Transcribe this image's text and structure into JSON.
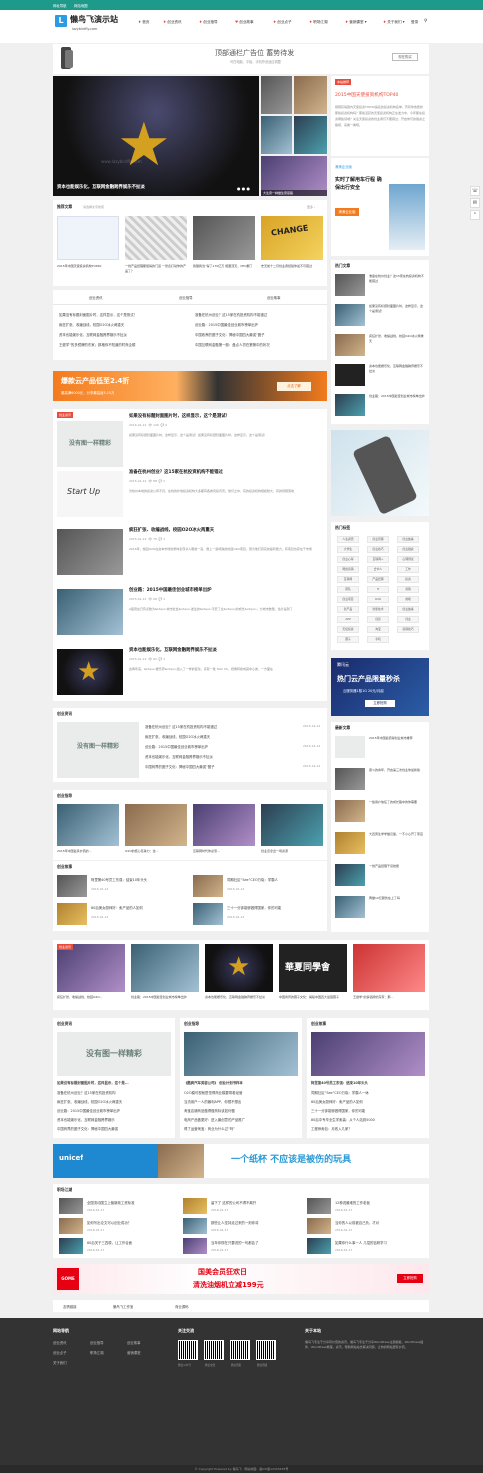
{
  "topbar": {
    "link1": "网址导航",
    "link2": "网站地图"
  },
  "header": {
    "logo_letter": "L",
    "title": "懒鸟飞演示站",
    "subtitle": "lazybirdfly.com",
    "nav": [
      "首页",
      "创业资讯",
      "创业指导",
      "创业故事",
      "创业点子",
      "职场江湖",
      "营销课堂 ▾",
      "关于我们 ▾"
    ],
    "login": "登录"
  },
  "banner": {
    "line1": "顶部通栏广告位 蓄势待发",
    "line2": "可在电脑、平板、手机外设适应调整",
    "button": "现在购买"
  },
  "slider": {
    "main_caption": "资本也能娱乐化，互联网金融跨界娱乐不扯淡",
    "watermark": "www.lazybirdfly.com",
    "caption_b": "大生意一种做生意思路"
  },
  "hot": {
    "badge": "本站推荐",
    "title": "2015中国天使投资机构TOP40",
    "desc": "刚刚获得国内天使投资TOP40提名的投资机构名单，芳有你熟悉的那些投资机构吗？那些活跃的天使投资机构正在发力中，今年都在投资哪些领域？关注天使投资的创业者们不要错过，开启你们的融资之路吧，来看一看吧。"
  },
  "ad_card": {
    "brand": "滴滴企业版",
    "head": "实时了解用车行程 确保出行安全",
    "sub": "滴滴企业版"
  },
  "recommend": {
    "title": "推荐文章",
    "search_hint": "请选择文字搜索",
    "more": "更多 ›",
    "items": [
      "2015年中国天使投资机构TOP40",
      "一线产品经理都懂得的门道 一张表打动你的产品了？",
      "我赌我当“得了170亿万 能跟顶天，CEO翻了",
      "史无前十二月创业者经验你最不可错过"
    ]
  },
  "tabs": {
    "t1": "创业资讯",
    "t2": "创业指导",
    "t3": "创业故事",
    "col1": [
      "如果没有标题封面图片时，这样显示，这个是测试！",
      "疯狂扩张、收编战线，校园O2O冰火两重天",
      "资本也能娱乐化，互联网金融跨界娱乐不扯淡",
      "王健学“的多镜牌的东家；那格你不知道的时商企顺"
    ],
    "col2": [
      "准备在杭州创业？这15家在杭投资机构不能错过",
      "创业路：2015中国最佳创业城市榜单出炉",
      "中国收养的圈子文化：揭秘中国四大最强“圈子",
      "中国互联网金融第一股：盘点人贷在第第中的状况"
    ]
  },
  "ad_wide": {
    "line1": "爆款云产品低至2.4折",
    "line2": "最高满6000元，分享最高返5.15万",
    "button": "点击了解"
  },
  "sidebar_hot": {
    "title": "热门文章",
    "items": [
      "准备在杭州创业？这15家在杭投资机构不能错过",
      "如果没有标题封面图片时，这样显示，这个是测试！",
      "疯狂扩张、收编战线，校园O2O冰火两重天",
      "资本也能娱乐化，互联网金融跨界娱乐不扯淡",
      "创业路：2015中国最佳创业城市榜单出炉"
    ],
    "date": "2015-01-12"
  },
  "list_articles": [
    {
      "title": "如果没有标题封面图片时，这样显示，这个是测试！",
      "img": "没有图一样精彩",
      "desc": "如果没有标题封面图片时，这样显示，这个是测试！如果没有标题封面图片时，这样显示，这个是测试！"
    },
    {
      "title": "准备在杭州创业？这15家在杭投资机构不能错过",
      "desc": "为杭州本地的投资公司不同，在杭的外地投资机构大多都有各类风投背景。他们之中，有的投资机构规模较大，有的则刚落地"
    },
    {
      "title": "疯狂扩张、收编战线，校园O2O冰火两重天",
      "desc": "2015年，校园O2O在资本市场的整体表现令人眼前一亮，像上一些特殊的校园O2O项目，因为他们真实的赢利能力，有项目也存在于市场"
    },
    {
      "title": "创业路：2015中国最佳创业城市榜单出炉",
      "desc": "A股现在已有点数为&ldquo;城市社会&rdquo;发生的&ldquo;平安了全&rdquo;的成长&rdquo;，分城市数量，估计是到了"
    },
    {
      "title": "资本也能娱乐化，互联网金融跨界娱乐不扯淡",
      "desc": "这两年来，&ldquo;娱乐界&rdquo;加入了一样的变化，实际一批 Star VC，视角转换成其中心类，一方面在"
    }
  ],
  "section1": {
    "title": "创业资讯",
    "img": "没有图一样精彩",
    "items": [
      "准备在杭州创业？这15家在杭投资机构不能错过",
      "疯狂扩张、收编战线，校园O2O冰火两重天",
      "创业路：2015中国最佳创业城市榜单出炉",
      "资本也能娱乐化，互联网金融跨界娱乐不扯淡",
      "中国商界的圈子文化：揭秘中国四大最强“圈子"
    ],
    "date": "2015-01-12"
  },
  "section2": {
    "title": "创业指导",
    "items": [
      "2015年中国最具价值的...",
      "O2O的核心竞争力：这...",
      "互联网时代你必须...",
      "创业该拿出一场资源"
    ]
  },
  "section3": {
    "title": "创业故事",
    "items": [
      "阿里第40号员工东强：结束10年头头",
      "同期社区“See”CEO万晓：学霸人",
      "80后美女厨师好：卖产品的人如何",
      "三十一分钟能够做得国家，你的可能"
    ],
    "date": "2015-01-12"
  },
  "sidebar_tags": {
    "title": "热门标签",
    "tags": [
      "人生感悟",
      "创业历程",
      "创业故事",
      "大学生",
      "创业技巧",
      "创业融资",
      "创业心得",
      "互联网+",
      "心理测试",
      "网络营销",
      "合伙人",
      "工作",
      "互联网",
      "产品经理",
      "投资",
      "团队",
      "IT",
      "营销",
      "创业项目",
      "O2O",
      "前端",
      "新产品",
      "智能技术",
      "创业故事",
      "APP",
      "创意",
      "创业",
      "天使投资",
      "淘宝",
      "营销技巧",
      "圈子",
      "手机"
    ]
  },
  "ad_side": {
    "brand": "腾讯云",
    "line1": "热门云产品限量秒杀",
    "line2": "云服务器1核1G 20元/月起",
    "button": "立即抢购"
  },
  "sidebar_new": {
    "title": "最新文章",
    "items": [
      "2015年中国最值得创业城市推荐",
      "奋斗的青年，开启第三次创业你最新版",
      "一些用户信任了的成长路中的你需要",
      "大四男生学学做汉堡，一不小心开了家店",
      "一线产品经理干货技能",
      "再做10亿服务在上了吗"
    ],
    "date": "2015-01-12"
  },
  "grid5": [
    "疯狂扩张、收编战线，校园O2O...",
    "创业路：2015中国最佳创业城市榜单出炉",
    "资本也能娱乐化，互联网金融跨界娱乐不扯淡",
    "中国商界的圈子文化：揭秘中国四大最强圈子",
    "王健学“的多镜牌的东家：那..."
  ],
  "three_cols": {
    "col1": {
      "title": "创业资讯",
      "img": "没有图一样精彩",
      "lead": "如果没有标题封面图片时，这样显示，这个是...",
      "items": [
        "准备在杭州创业？这15家在杭投资机构",
        "疯狂扩张、收编战线，校园O2O冰火两重天",
        "创业路：2015中国最佳创业城市榜单出炉",
        "资本也能娱乐化，互联网金融跨界娱乐",
        "中国商界的圈子文化：揭秘中国四大最强"
      ]
    },
    "col2": {
      "title": "创业指导",
      "lead": "《酷爽汽车美容公司》 创业计划书样本",
      "items": [
        "O2O模可视就是觉得商业模要带着经营",
        "当流用户一人的暴利APP，你想不想出",
        "淘宝店铺商品做得做商标该如何做",
        "电商产品做更好：进入最创意的产品推广",
        "得了运营淘宝：商业为什么过“吗”"
      ]
    },
    "col3": {
      "title": "创业故事",
      "lead": "阿里第40号员工东强：结束10年头头",
      "items": [
        "同期社区“See”CEO万晓：学霸人一休",
        "80后美女厨师好：卖产品的人如何",
        "三十一分钟能够做得国家，你的可能",
        "80后中专毕业生学卖装：从个人站到5000",
        "工程师卖包：月收入几家？"
      ]
    }
  },
  "unicef": {
    "brand": "unicef",
    "slogan": "一个纸杯 不应该是被伤的玩具"
  },
  "career": {
    "title": "职场江湖",
    "items": [
      "全国流动国立上管新政工资标准",
      "如何写出论文可以创业成功？",
      "80后关于三四原，让工作合面",
      "留下了 这样的公司不得不离开",
      "那些让人坚持走过来的一刻你将",
      "当年你现在只要说的一句都会了",
      "12种说最难的工作老板",
      "当你的人以前被自己负，才对",
      "如果你什么事一人 几招的钻研学习"
    ],
    "date": "2016-01-17"
  },
  "ad_gome": {
    "brand": "GOME",
    "line1": "国美会员狂欢日",
    "line2": "清洗油烟机立减199元",
    "button": "立即抢购"
  },
  "friend_links": [
    "友情链接",
    "懒鸟飞工作室",
    "商业源码"
  ],
  "footer": {
    "col1_title": "网站导航",
    "col1": [
      "创业资讯",
      "创业指导",
      "创业故事",
      "创业点子",
      "职场江湖",
      "营销课堂",
      "关于我们"
    ],
    "col2_title": "关注交流",
    "qr": [
      "微信公众号",
      "微信交流",
      "微信赞助",
      "微信群组"
    ],
    "col3_title": "关于本站",
    "col3": "懒鸟飞专注于分享有价值的资讯，懒鸟飞专注于分享WordPress主题模板、WordPress插件、WordPress教程，资讯，帮助网站站长解决问题，让你的网站更有价值。"
  },
  "copyright": "© Copyright Powered by 懒鸟飞 · 网站地图 · 备ICP备12345678号",
  "colors": {
    "accent": "#1e9a8b",
    "red": "#e74c3c",
    "orange": "#f37b1d",
    "footer": "#333333"
  }
}
